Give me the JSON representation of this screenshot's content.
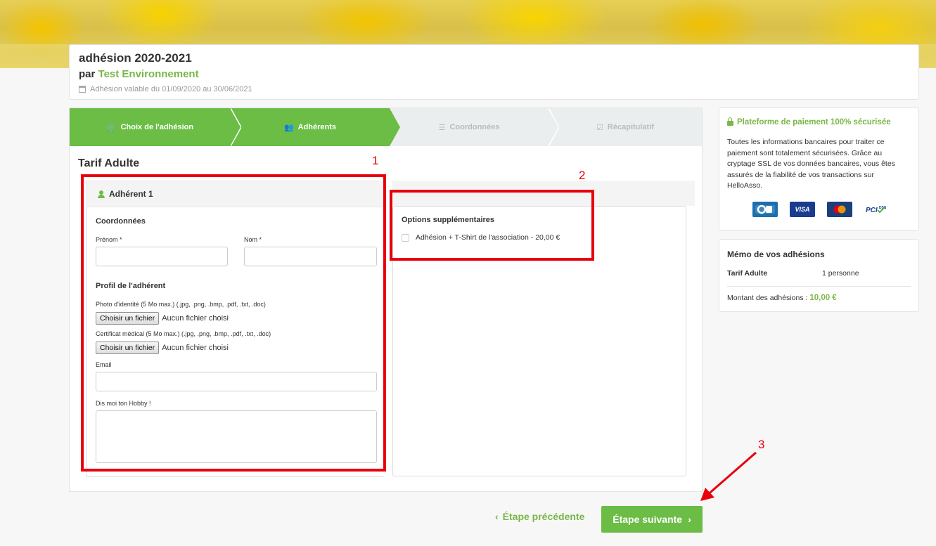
{
  "header": {
    "title": "adhésion 2020-2021",
    "par_label": "par",
    "organization": "Test Environnement",
    "validity": "Adhésion valable du 01/09/2020 au 30/06/2021"
  },
  "steps": [
    {
      "label": "Choix de l'adhésion",
      "icon": "cart-icon",
      "state": "done"
    },
    {
      "label": "Adhérents",
      "icon": "users-icon",
      "state": "current"
    },
    {
      "label": "Coordonnées",
      "icon": "list-icon",
      "state": "todo"
    },
    {
      "label": "Récapitulatif",
      "icon": "checkbox-icon",
      "state": "todo"
    }
  ],
  "form": {
    "tarif_title": "Tarif Adulte",
    "adherent_label": "Adhérent 1",
    "coordonnees_title": "Coordonnées",
    "prenom_label": "Prénom *",
    "prenom_value": "",
    "nom_label": "Nom *",
    "nom_value": "",
    "profil_title": "Profil de l'adhérent",
    "photo_label": "Photo d'identité (5 Mo max.) (.jpg, .png, .bmp, .pdf, .txt, .doc)",
    "certificat_label": "Certificat médical (5 Mo max.) (.jpg, .png, .bmp, .pdf, .txt, .doc)",
    "file_button": "Choisir un fichier",
    "no_file": "Aucun fichier choisi",
    "email_label": "Email",
    "email_value": "",
    "hobby_label": "Dis moi ton Hobby !",
    "hobby_value": ""
  },
  "options": {
    "title": "Options supplémentaires",
    "item_label": "Adhésion + T-Shirt de l'association - 20,00 €",
    "item_checked": false
  },
  "navigation": {
    "prev_label": "Étape précédente",
    "next_label": "Étape suivante",
    "prev_chevron": "‹",
    "next_chevron": "›"
  },
  "sidebar": {
    "secure_title": "Plateforme de paiement 100% sécurisée",
    "secure_text": "Toutes les informations bancaires pour traiter ce paiement sont totalement sécurisées. Grâce au cryptage SSL de vos données bancaires, vous êtes assurés de la fiabilité de vos transactions sur HelloAsso.",
    "payment_cards": [
      {
        "name": "CB",
        "color": "#1a6fb0"
      },
      {
        "name": "VISA",
        "color": "#1a3c8f"
      },
      {
        "name": "MC",
        "color": "#1b3f7a"
      },
      {
        "name": "PCI DSS",
        "color": "#ffffff"
      }
    ],
    "memo_title": "Mémo de vos adhésions",
    "memo_tarif": "Tarif Adulte",
    "memo_count": "1 personne",
    "memo_total_label": "Montant des adhésions :",
    "memo_total_value": "10,00 €"
  },
  "annotations": {
    "one": "1",
    "two": "2",
    "three": "3"
  },
  "colors": {
    "brand_green": "#6bbd45",
    "annotation_red": "#e8000d"
  }
}
